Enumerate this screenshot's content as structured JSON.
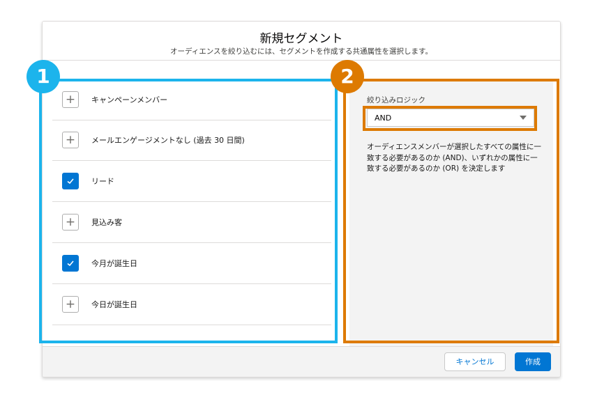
{
  "modal": {
    "title": "新規セグメント",
    "subtitle": "オーディエンスを絞り込むには、セグメントを作成する共通属性を選択します。"
  },
  "attributes": [
    {
      "label": "キャンペーンメンバー",
      "checked": false,
      "icon": "plus-icon"
    },
    {
      "label": "メールエンゲージメントなし (過去 30 日間)",
      "checked": false,
      "icon": "plus-icon"
    },
    {
      "label": "リード",
      "checked": true,
      "icon": "check-icon"
    },
    {
      "label": "見込み客",
      "checked": false,
      "icon": "plus-icon"
    },
    {
      "label": "今月が誕生日",
      "checked": true,
      "icon": "check-icon"
    },
    {
      "label": "今日が誕生日",
      "checked": false,
      "icon": "plus-icon"
    }
  ],
  "filter_logic": {
    "label": "絞り込みロジック",
    "selected": "AND",
    "description": "オーディエンスメンバーが選択したすべての属性に一致する必要があるのか (AND)、いずれかの属性に一致する必要があるのか (OR) を決定します"
  },
  "footer": {
    "cancel_label": "キャンセル",
    "create_label": "作成"
  },
  "annotations": {
    "badge_1": "1",
    "badge_2": "2"
  },
  "colors": {
    "primary": "#0176d3",
    "annotation_blue": "#1cb4ec",
    "annotation_orange": "#dd7a01"
  }
}
